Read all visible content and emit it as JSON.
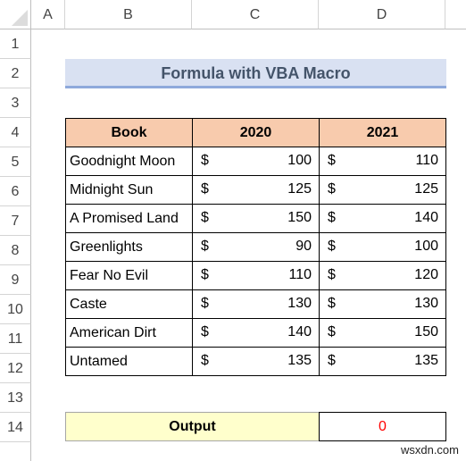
{
  "spreadsheet": {
    "columns": [
      "A",
      "B",
      "C",
      "D"
    ],
    "rows": [
      "1",
      "2",
      "3",
      "4",
      "5",
      "6",
      "7",
      "8",
      "9",
      "10",
      "11",
      "12",
      "13",
      "14"
    ]
  },
  "title": "Formula with VBA Macro",
  "table": {
    "headers": [
      "Book",
      "2020",
      "2021"
    ],
    "currency_symbol": "$",
    "rows": [
      {
        "book": "Goodnight Moon",
        "y2020": "100",
        "y2021": "110"
      },
      {
        "book": "Midnight Sun",
        "y2020": "125",
        "y2021": "125"
      },
      {
        "book": "A Promised Land",
        "y2020": "150",
        "y2021": "140"
      },
      {
        "book": "Greenlights",
        "y2020": "90",
        "y2021": "100"
      },
      {
        "book": "Fear No Evil",
        "y2020": "110",
        "y2021": "120"
      },
      {
        "book": "Caste",
        "y2020": "130",
        "y2021": "130"
      },
      {
        "book": "American Dirt",
        "y2020": "140",
        "y2021": "150"
      },
      {
        "book": "Untamed",
        "y2020": "135",
        "y2021": "135"
      }
    ]
  },
  "output": {
    "label": "Output",
    "value": "0"
  },
  "colors": {
    "title_fill": "#D9E1F2",
    "title_text": "#44546A",
    "header_fill": "#F8CBAD",
    "output_fill": "#FFFFCC",
    "output_value": "#FF0000"
  },
  "watermark": "wsxdn.com"
}
